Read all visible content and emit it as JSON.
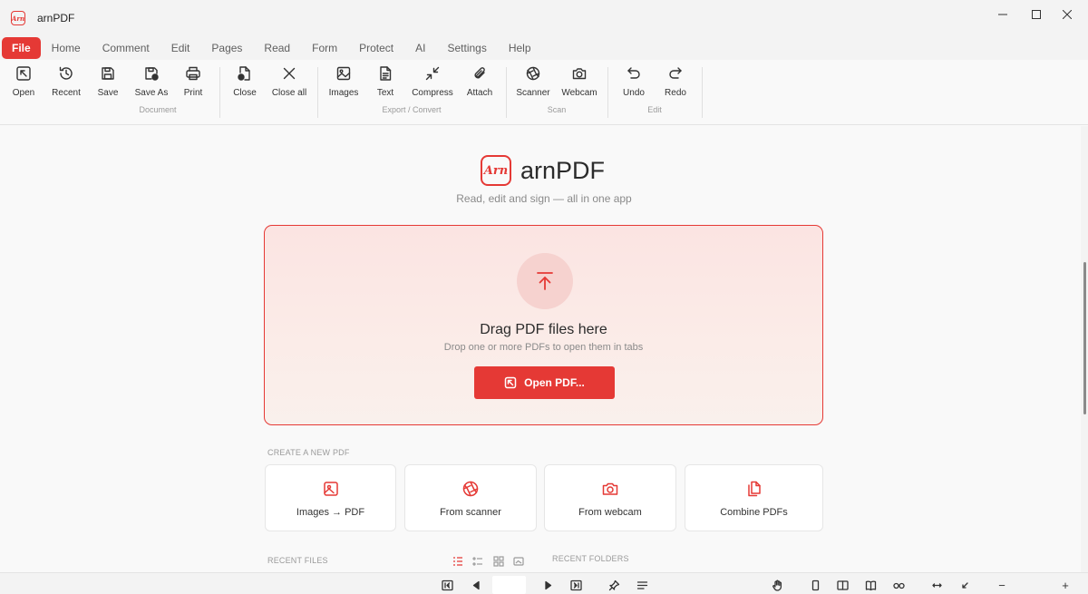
{
  "window": {
    "title": "arnPDF",
    "logo_text": "Arn"
  },
  "menu": {
    "items": [
      "File",
      "Home",
      "Comment",
      "Edit",
      "Pages",
      "Read",
      "Form",
      "Protect",
      "AI",
      "Settings",
      "Help"
    ],
    "active": "File"
  },
  "ribbon": {
    "buttons": {
      "open": "Open",
      "recent": "Recent",
      "save": "Save",
      "save_as": "Save As",
      "print": "Print",
      "close": "Close",
      "close_all": "Close all",
      "images": "Images",
      "text": "Text",
      "compress": "Compress",
      "attach": "Attach",
      "scanner": "Scanner",
      "webcam": "Webcam",
      "undo": "Undo",
      "redo": "Redo"
    },
    "groups": {
      "document": "Document",
      "export_convert": "Export / Convert",
      "scan": "Scan",
      "edit": "Edit"
    }
  },
  "hero": {
    "logo_text": "Arn",
    "title": "arnPDF",
    "subtitle": "Read, edit and sign — all in one app"
  },
  "dropzone": {
    "title": "Drag PDF files here",
    "subtitle": "Drop one or more PDFs to open them in tabs",
    "button_label": "Open PDF..."
  },
  "create": {
    "section_label": "CREATE A NEW PDF",
    "cards": {
      "images_to_pdf": "Images → PDF",
      "from_scanner": "From scanner",
      "from_webcam": "From webcam",
      "combine_pdfs": "Combine PDFs"
    }
  },
  "recent": {
    "files_label": "RECENT FILES",
    "folders_label": "RECENT FOLDERS"
  },
  "statusbar": {
    "page_value": "",
    "zoom_out": "−",
    "zoom_in": "+"
  },
  "colors": {
    "accent": "#e53935"
  }
}
